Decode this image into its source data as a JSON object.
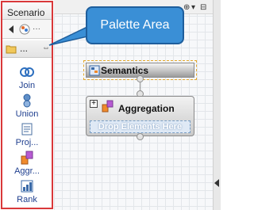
{
  "palette": {
    "title": "Scenario",
    "drawer_label": "...",
    "tools": [
      {
        "label": "Join",
        "icon": "join-icon"
      },
      {
        "label": "Union",
        "icon": "union-icon"
      },
      {
        "label": "Proj...",
        "icon": "projection-icon"
      },
      {
        "label": "Aggr...",
        "icon": "aggregation-icon"
      },
      {
        "label": "Rank",
        "icon": "rank-icon"
      }
    ]
  },
  "callout": {
    "text": "Palette Area"
  },
  "nodes": {
    "semantics": {
      "title": "Semantics"
    },
    "aggregation": {
      "title": "Aggregation",
      "drop_placeholder": "Drop Elements Here"
    }
  },
  "colors": {
    "palette_border": "#d9383a",
    "callout_fill": "#3a8fd6",
    "selection_dash": "#e3a72a"
  }
}
